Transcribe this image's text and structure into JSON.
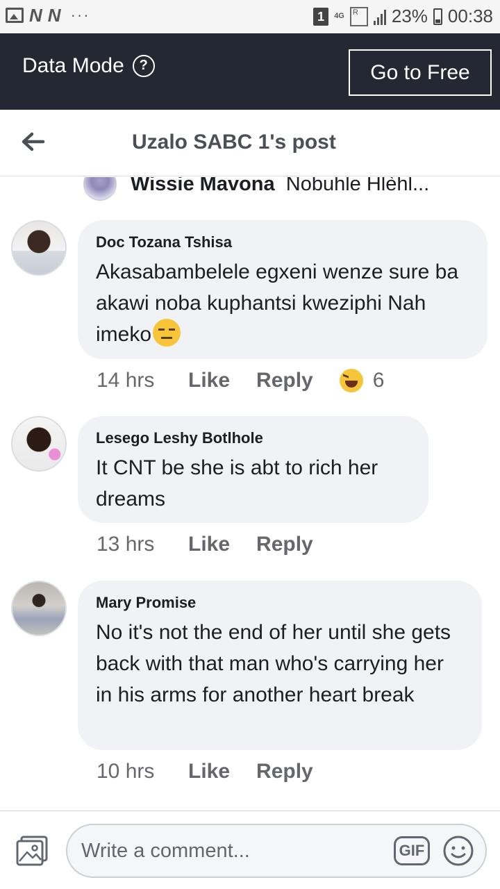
{
  "status_bar": {
    "carrier_icons": [
      "N",
      "N"
    ],
    "more": "···",
    "sim_slot": "1",
    "network": "4G",
    "battery": "23%",
    "time": "00:38"
  },
  "banner": {
    "title": "Data Mode",
    "help": "?",
    "cta": "Go to Free"
  },
  "header": {
    "title": "Uzalo SABC 1's post"
  },
  "previous_comment": {
    "name": "Wissie Mavona",
    "text": "Nobuhle Hlèhl..."
  },
  "comments": [
    {
      "name": "Doc Tozana Tshisa",
      "text": "Akasabambelele egxeni wenze sure ba akawi noba kuphantsi kweziphi Nah imeko",
      "time": "14 hrs",
      "like": "Like",
      "reply": "Reply",
      "reaction_count": "6"
    },
    {
      "name": "Lesego Leshy Botlhole",
      "text": "It CNT be she is abt to rich her dreams",
      "time": "13 hrs",
      "like": "Like",
      "reply": "Reply"
    },
    {
      "name": "Mary Promise",
      "text": "No it's not  the end of her until she gets back with that man who's carrying her in his arms for another heart break",
      "time": "10 hrs",
      "like": "Like",
      "reply": "Reply"
    }
  ],
  "composer": {
    "placeholder": "Write a comment...",
    "gif": "GIF"
  }
}
